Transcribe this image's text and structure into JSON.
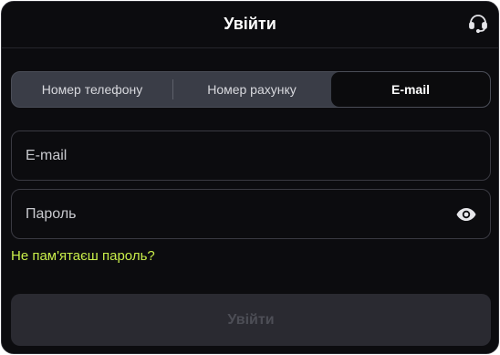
{
  "header": {
    "title": "Увійти",
    "support_icon": "headset-icon"
  },
  "tabs": [
    {
      "label": "Номер телефону",
      "active": false
    },
    {
      "label": "Номер рахунку",
      "active": false
    },
    {
      "label": "E-mail",
      "active": true
    }
  ],
  "form": {
    "email": {
      "placeholder": "E-mail",
      "value": ""
    },
    "password": {
      "placeholder": "Пароль",
      "value": "",
      "toggle_icon": "eye-icon"
    },
    "forgot_label": "Не пам'ятаєш пароль?",
    "submit_label": "Увійти",
    "submit_disabled": true
  },
  "colors": {
    "background": "#0c0c0f",
    "accent_link": "#c9ee4a",
    "tab_bar": "#3a3d47",
    "tab_active": "#0b0b0d",
    "submit_disabled_bg": "#2a2a31",
    "submit_disabled_text": "#4d4e56"
  }
}
